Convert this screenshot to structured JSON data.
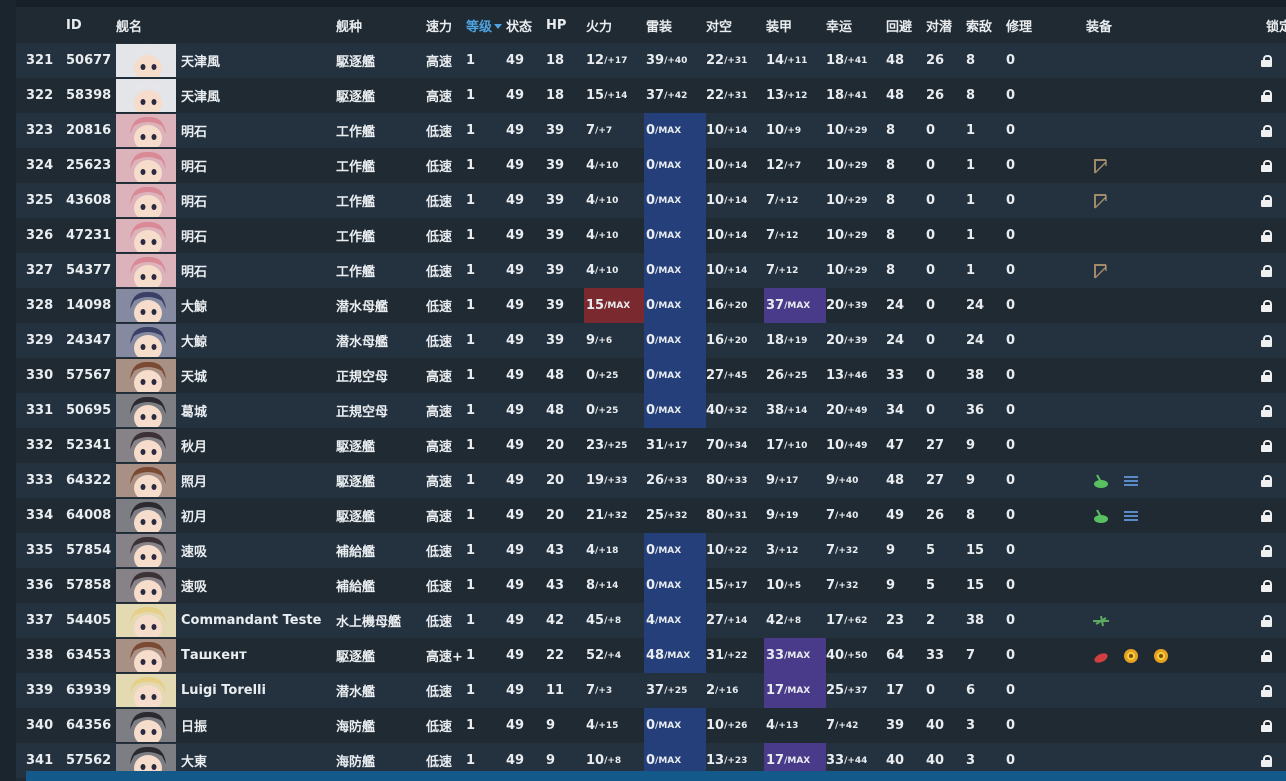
{
  "headers": [
    "ID",
    "舰名",
    "舰种",
    "速力",
    "等级",
    "状态",
    "HP",
    "火力",
    "雷装",
    "对空",
    "装甲",
    "幸运",
    "回避",
    "对潜",
    "索敌",
    "修理",
    "装备",
    "锁定"
  ],
  "sorted_column": "等级",
  "colors": {
    "hair_white": "#e6e6ea",
    "hair_pink": "#d98a96",
    "hair_navy": "#3a3f66",
    "hair_brown": "#7a4a32",
    "hair_black": "#2a2a30",
    "hair_blonde": "#e6cf86",
    "hair_dark": "#3c3236"
  },
  "rows": [
    {
      "no": "321",
      "id": "50677",
      "name": "天津風",
      "type": "駆逐艦",
      "speed": "高速",
      "lv": "1",
      "cond": "49",
      "hp": "18",
      "fp": [
        "12",
        "/+17"
      ],
      "tp": [
        "39",
        "/+40"
      ],
      "aa": [
        "22",
        "/+31"
      ],
      "ar": [
        "14",
        "/+11"
      ],
      "lk": [
        "18",
        "/+41"
      ],
      "ev": "48",
      "asw": "26",
      "los": "8",
      "rep": "0",
      "hair": "hair_white",
      "equip": []
    },
    {
      "no": "322",
      "id": "58398",
      "name": "天津風",
      "type": "駆逐艦",
      "speed": "高速",
      "lv": "1",
      "cond": "49",
      "hp": "18",
      "fp": [
        "15",
        "/+14"
      ],
      "tp": [
        "37",
        "/+42"
      ],
      "aa": [
        "22",
        "/+31"
      ],
      "ar": [
        "13",
        "/+12"
      ],
      "lk": [
        "18",
        "/+41"
      ],
      "ev": "48",
      "asw": "26",
      "los": "8",
      "rep": "0",
      "hair": "hair_white",
      "equip": []
    },
    {
      "no": "323",
      "id": "20816",
      "name": "明石",
      "type": "工作艦",
      "speed": "低速",
      "lv": "1",
      "cond": "49",
      "hp": "39",
      "fp": [
        "7",
        "/+7"
      ],
      "tp": [
        "0",
        "/MAX"
      ],
      "aa": [
        "10",
        "/+14"
      ],
      "ar": [
        "10",
        "/+9"
      ],
      "lk": [
        "10",
        "/+29"
      ],
      "ev": "8",
      "asw": "0",
      "los": "1",
      "rep": "0",
      "hair": "hair_pink",
      "equip": [],
      "tp_hl": "blue"
    },
    {
      "no": "324",
      "id": "25623",
      "name": "明石",
      "type": "工作艦",
      "speed": "低速",
      "lv": "1",
      "cond": "49",
      "hp": "39",
      "fp": [
        "4",
        "/+10"
      ],
      "tp": [
        "0",
        "/MAX"
      ],
      "aa": [
        "10",
        "/+14"
      ],
      "ar": [
        "12",
        "/+7"
      ],
      "lk": [
        "10",
        "/+29"
      ],
      "ev": "8",
      "asw": "0",
      "los": "1",
      "rep": "0",
      "hair": "hair_pink",
      "equip": [
        "crane-icon"
      ],
      "tp_hl": "blue"
    },
    {
      "no": "325",
      "id": "43608",
      "name": "明石",
      "type": "工作艦",
      "speed": "低速",
      "lv": "1",
      "cond": "49",
      "hp": "39",
      "fp": [
        "4",
        "/+10"
      ],
      "tp": [
        "0",
        "/MAX"
      ],
      "aa": [
        "10",
        "/+14"
      ],
      "ar": [
        "7",
        "/+12"
      ],
      "lk": [
        "10",
        "/+29"
      ],
      "ev": "8",
      "asw": "0",
      "los": "1",
      "rep": "0",
      "hair": "hair_pink",
      "equip": [
        "crane-icon"
      ],
      "tp_hl": "blue"
    },
    {
      "no": "326",
      "id": "47231",
      "name": "明石",
      "type": "工作艦",
      "speed": "低速",
      "lv": "1",
      "cond": "49",
      "hp": "39",
      "fp": [
        "4",
        "/+10"
      ],
      "tp": [
        "0",
        "/MAX"
      ],
      "aa": [
        "10",
        "/+14"
      ],
      "ar": [
        "7",
        "/+12"
      ],
      "lk": [
        "10",
        "/+29"
      ],
      "ev": "8",
      "asw": "0",
      "los": "1",
      "rep": "0",
      "hair": "hair_pink",
      "equip": [],
      "tp_hl": "blue"
    },
    {
      "no": "327",
      "id": "54377",
      "name": "明石",
      "type": "工作艦",
      "speed": "低速",
      "lv": "1",
      "cond": "49",
      "hp": "39",
      "fp": [
        "4",
        "/+10"
      ],
      "tp": [
        "0",
        "/MAX"
      ],
      "aa": [
        "10",
        "/+14"
      ],
      "ar": [
        "7",
        "/+12"
      ],
      "lk": [
        "10",
        "/+29"
      ],
      "ev": "8",
      "asw": "0",
      "los": "1",
      "rep": "0",
      "hair": "hair_pink",
      "equip": [
        "crane-icon"
      ],
      "tp_hl": "blue"
    },
    {
      "no": "328",
      "id": "14098",
      "name": "大鯨",
      "type": "潜水母艦",
      "speed": "低速",
      "lv": "1",
      "cond": "49",
      "hp": "39",
      "fp": [
        "15",
        "/MAX"
      ],
      "tp": [
        "0",
        "/MAX"
      ],
      "aa": [
        "16",
        "/+20"
      ],
      "ar": [
        "37",
        "/MAX"
      ],
      "lk": [
        "20",
        "/+39"
      ],
      "ev": "24",
      "asw": "0",
      "los": "24",
      "rep": "0",
      "hair": "hair_navy",
      "equip": [],
      "fp_hl": "red",
      "tp_hl": "blue",
      "ar_hl": "purple"
    },
    {
      "no": "329",
      "id": "24347",
      "name": "大鯨",
      "type": "潜水母艦",
      "speed": "低速",
      "lv": "1",
      "cond": "49",
      "hp": "39",
      "fp": [
        "9",
        "/+6"
      ],
      "tp": [
        "0",
        "/MAX"
      ],
      "aa": [
        "16",
        "/+20"
      ],
      "ar": [
        "18",
        "/+19"
      ],
      "lk": [
        "20",
        "/+39"
      ],
      "ev": "24",
      "asw": "0",
      "los": "24",
      "rep": "0",
      "hair": "hair_navy",
      "equip": [],
      "tp_hl": "blue"
    },
    {
      "no": "330",
      "id": "57567",
      "name": "天城",
      "type": "正規空母",
      "speed": "高速",
      "lv": "1",
      "cond": "49",
      "hp": "48",
      "fp": [
        "0",
        "/+25"
      ],
      "tp": [
        "0",
        "/MAX"
      ],
      "aa": [
        "27",
        "/+45"
      ],
      "ar": [
        "26",
        "/+25"
      ],
      "lk": [
        "13",
        "/+46"
      ],
      "ev": "33",
      "asw": "0",
      "los": "38",
      "rep": "0",
      "hair": "hair_brown",
      "equip": [],
      "tp_hl": "blue"
    },
    {
      "no": "331",
      "id": "50695",
      "name": "葛城",
      "type": "正規空母",
      "speed": "高速",
      "lv": "1",
      "cond": "49",
      "hp": "48",
      "fp": [
        "0",
        "/+25"
      ],
      "tp": [
        "0",
        "/MAX"
      ],
      "aa": [
        "40",
        "/+32"
      ],
      "ar": [
        "38",
        "/+14"
      ],
      "lk": [
        "20",
        "/+49"
      ],
      "ev": "34",
      "asw": "0",
      "los": "36",
      "rep": "0",
      "hair": "hair_black",
      "equip": [],
      "tp_hl": "blue"
    },
    {
      "no": "332",
      "id": "52341",
      "name": "秋月",
      "type": "駆逐艦",
      "speed": "高速",
      "lv": "1",
      "cond": "49",
      "hp": "20",
      "fp": [
        "23",
        "/+25"
      ],
      "tp": [
        "31",
        "/+17"
      ],
      "aa": [
        "70",
        "/+34"
      ],
      "ar": [
        "17",
        "/+10"
      ],
      "lk": [
        "10",
        "/+49"
      ],
      "ev": "47",
      "asw": "27",
      "los": "9",
      "rep": "0",
      "hair": "hair_dark",
      "equip": []
    },
    {
      "no": "333",
      "id": "64322",
      "name": "照月",
      "type": "駆逐艦",
      "speed": "高速",
      "lv": "1",
      "cond": "49",
      "hp": "20",
      "fp": [
        "19",
        "/+33"
      ],
      "tp": [
        "26",
        "/+33"
      ],
      "aa": [
        "80",
        "/+33"
      ],
      "ar": [
        "9",
        "/+17"
      ],
      "lk": [
        "9",
        "/+40"
      ],
      "ev": "48",
      "asw": "27",
      "los": "9",
      "rep": "0",
      "hair": "hair_brown",
      "equip": [
        "gun-icon",
        "radar-icon"
      ]
    },
    {
      "no": "334",
      "id": "64008",
      "name": "初月",
      "type": "駆逐艦",
      "speed": "高速",
      "lv": "1",
      "cond": "49",
      "hp": "20",
      "fp": [
        "21",
        "/+32"
      ],
      "tp": [
        "25",
        "/+32"
      ],
      "aa": [
        "80",
        "/+31"
      ],
      "ar": [
        "9",
        "/+19"
      ],
      "lk": [
        "7",
        "/+40"
      ],
      "ev": "49",
      "asw": "26",
      "los": "8",
      "rep": "0",
      "hair": "hair_black",
      "equip": [
        "gun-icon",
        "radar-icon"
      ]
    },
    {
      "no": "335",
      "id": "57854",
      "name": "速吸",
      "type": "補給艦",
      "speed": "低速",
      "lv": "1",
      "cond": "49",
      "hp": "43",
      "fp": [
        "4",
        "/+18"
      ],
      "tp": [
        "0",
        "/MAX"
      ],
      "aa": [
        "10",
        "/+22"
      ],
      "ar": [
        "3",
        "/+12"
      ],
      "lk": [
        "7",
        "/+32"
      ],
      "ev": "9",
      "asw": "5",
      "los": "15",
      "rep": "0",
      "hair": "hair_dark",
      "equip": [],
      "tp_hl": "blue"
    },
    {
      "no": "336",
      "id": "57858",
      "name": "速吸",
      "type": "補給艦",
      "speed": "低速",
      "lv": "1",
      "cond": "49",
      "hp": "43",
      "fp": [
        "8",
        "/+14"
      ],
      "tp": [
        "0",
        "/MAX"
      ],
      "aa": [
        "15",
        "/+17"
      ],
      "ar": [
        "10",
        "/+5"
      ],
      "lk": [
        "7",
        "/+32"
      ],
      "ev": "9",
      "asw": "5",
      "los": "15",
      "rep": "0",
      "hair": "hair_dark",
      "equip": [],
      "tp_hl": "blue"
    },
    {
      "no": "337",
      "id": "54405",
      "name": "Commandant Teste",
      "type": "水上機母艦",
      "speed": "低速",
      "lv": "1",
      "cond": "49",
      "hp": "42",
      "fp": [
        "45",
        "/+8"
      ],
      "tp": [
        "4",
        "/MAX"
      ],
      "aa": [
        "27",
        "/+14"
      ],
      "ar": [
        "42",
        "/+8"
      ],
      "lk": [
        "17",
        "/+62"
      ],
      "ev": "23",
      "asw": "2",
      "los": "38",
      "rep": "0",
      "hair": "hair_blonde",
      "equip": [
        "seaplane-icon"
      ],
      "tp_hl": "blue"
    },
    {
      "no": "338",
      "id": "63453",
      "name": "Ташкент",
      "type": "駆逐艦",
      "speed": "高速+",
      "lv": "1",
      "cond": "49",
      "hp": "22",
      "fp": [
        "52",
        "/+4"
      ],
      "tp": [
        "48",
        "/MAX"
      ],
      "aa": [
        "31",
        "/+22"
      ],
      "ar": [
        "33",
        "/MAX"
      ],
      "lk": [
        "40",
        "/+50"
      ],
      "ev": "64",
      "asw": "33",
      "los": "7",
      "rep": "0",
      "hair": "hair_brown",
      "equip": [
        "red-gun-icon",
        "sun-icon",
        "sun-icon"
      ],
      "tp_hl": "blue",
      "ar_hl": "purple"
    },
    {
      "no": "339",
      "id": "63939",
      "name": "Luigi Torelli",
      "type": "潜水艦",
      "speed": "低速",
      "lv": "1",
      "cond": "49",
      "hp": "11",
      "fp": [
        "7",
        "/+3"
      ],
      "tp": [
        "37",
        "/+25"
      ],
      "aa": [
        "2",
        "/+16"
      ],
      "ar": [
        "17",
        "/MAX"
      ],
      "lk": [
        "25",
        "/+37"
      ],
      "ev": "17",
      "asw": "0",
      "los": "6",
      "rep": "0",
      "hair": "hair_blonde",
      "equip": [],
      "ar_hl": "purple"
    },
    {
      "no": "340",
      "id": "64356",
      "name": "日振",
      "type": "海防艦",
      "speed": "低速",
      "lv": "1",
      "cond": "49",
      "hp": "9",
      "fp": [
        "4",
        "/+15"
      ],
      "tp": [
        "0",
        "/MAX"
      ],
      "aa": [
        "10",
        "/+26"
      ],
      "ar": [
        "4",
        "/+13"
      ],
      "lk": [
        "7",
        "/+42"
      ],
      "ev": "39",
      "asw": "40",
      "los": "3",
      "rep": "0",
      "hair": "hair_black",
      "equip": [],
      "tp_hl": "blue"
    },
    {
      "no": "341",
      "id": "57562",
      "name": "大東",
      "type": "海防艦",
      "speed": "低速",
      "lv": "1",
      "cond": "49",
      "hp": "9",
      "fp": [
        "10",
        "/+8"
      ],
      "tp": [
        "0",
        "/MAX"
      ],
      "aa": [
        "13",
        "/+23"
      ],
      "ar": [
        "17",
        "/MAX"
      ],
      "lk": [
        "33",
        "/+44"
      ],
      "ev": "40",
      "asw": "40",
      "los": "3",
      "rep": "0",
      "hair": "hair_black",
      "equip": [],
      "tp_hl": "blue",
      "ar_hl": "purple"
    }
  ]
}
